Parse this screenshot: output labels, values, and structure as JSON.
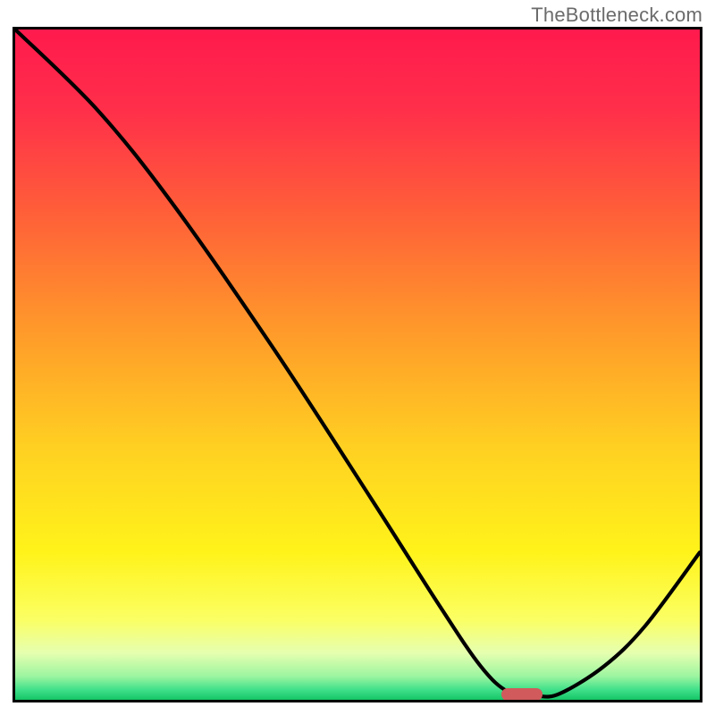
{
  "watermark": "TheBottleneck.com",
  "chart_data": {
    "type": "line",
    "title": "",
    "xlabel": "",
    "ylabel": "",
    "x_range": [
      0,
      100
    ],
    "y_range": [
      0,
      100
    ],
    "series": [
      {
        "name": "bottleneck-curve",
        "x": [
          0,
          12,
          23,
          38,
          52,
          62,
          68,
          72,
          76,
          79.5,
          86,
          92,
          100
        ],
        "y": [
          100,
          88,
          74,
          52,
          30,
          14,
          5,
          1.2,
          0.6,
          0.9,
          5,
          11,
          22
        ]
      }
    ],
    "optimal_marker": {
      "x_center": 74,
      "width": 6,
      "y": 0.8
    },
    "gradient_stops": [
      {
        "pct": 0,
        "color": "#ff1a4d"
      },
      {
        "pct": 12,
        "color": "#ff2f4a"
      },
      {
        "pct": 28,
        "color": "#ff6138"
      },
      {
        "pct": 45,
        "color": "#ff9a2a"
      },
      {
        "pct": 62,
        "color": "#ffcf22"
      },
      {
        "pct": 78,
        "color": "#fff31a"
      },
      {
        "pct": 88,
        "color": "#fbff63"
      },
      {
        "pct": 93,
        "color": "#e6ffb0"
      },
      {
        "pct": 96.5,
        "color": "#9cf5a0"
      },
      {
        "pct": 98.5,
        "color": "#40e08a"
      },
      {
        "pct": 100,
        "color": "#15c566"
      }
    ]
  },
  "layout": {
    "plot_inner_w": 766,
    "plot_inner_h": 750
  }
}
